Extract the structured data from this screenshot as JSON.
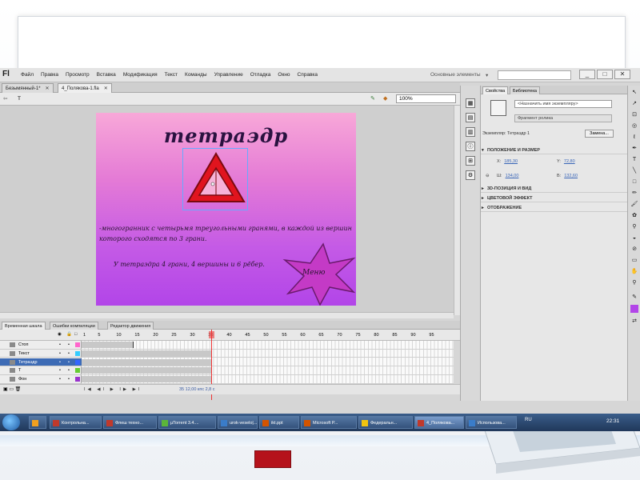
{
  "app": {
    "logo": "Fl",
    "menu": [
      "Файл",
      "Правка",
      "Просмотр",
      "Вставка",
      "Модификация",
      "Текст",
      "Команды",
      "Управление",
      "Отладка",
      "Окно",
      "Справка"
    ],
    "workspace": "Основные элементы",
    "window_buttons": [
      "_",
      "□",
      "✕"
    ]
  },
  "doc_tabs": [
    {
      "label": "Безымянный-1*",
      "active": false
    },
    {
      "label": "4_Полякова-1.fla",
      "active": true
    }
  ],
  "editbar": {
    "scene": "T",
    "zoom": "100%"
  },
  "stage": {
    "title": "тетраэдр",
    "description": "-многогранник с четырьмя треугольными гранями, в каждой из вершин которого сходятся по 3 грани.",
    "facts": "У тетраэдра 4 грани, 4  вершины и 6 рёбер.",
    "menu_label": "Меню"
  },
  "timeline": {
    "tabs": [
      "Временная шкала",
      "Ошибки компиляции",
      "Редактор движения"
    ],
    "ruler": [
      "1",
      "5",
      "10",
      "15",
      "20",
      "25",
      "30",
      "35",
      "40",
      "45",
      "50",
      "55",
      "60",
      "65",
      "70",
      "75",
      "80",
      "85",
      "90",
      "95"
    ],
    "layers": [
      {
        "name": "Стоп",
        "color": "#ff66cc",
        "selected": false,
        "frames": 0.14
      },
      {
        "name": "Текст",
        "color": "#33ccff",
        "selected": false,
        "frames": 0.35
      },
      {
        "name": "Тетраэдр",
        "color": "#3366ff",
        "selected": true,
        "frames": 0.35
      },
      {
        "name": "T",
        "color": "#66cc33",
        "selected": false,
        "frames": 0.35
      },
      {
        "name": "Фон",
        "color": "#9933cc",
        "selected": false,
        "frames": 0.35
      }
    ],
    "controls": "I◀ ◀I ▶ I▶ ▶I",
    "frame_info": "35    12,00 кпс    2,8 с"
  },
  "props": {
    "tabs": [
      "Свойства",
      "Библиотека"
    ],
    "instance_placeholder": "<Назначить имя экземпляру>",
    "symbol_type": "Фрагмент ролика",
    "instance_label": "Экземпляр:",
    "instance_name": "Тетраэдр 1",
    "swap_label": "Замена...",
    "sections": {
      "position": "ПОЛОЖЕНИЕ И РАЗМЕР",
      "3d": "3D-ПОЗИЦИЯ И ВИД",
      "color": "ЦВЕТОВОЙ ЭФФЕКТ",
      "display": "ОТОБРАЖЕНИЕ"
    },
    "x_label": "X:",
    "x_value": "185,30",
    "y_label": "Y:",
    "y_value": "72,80",
    "w_label": "Ш:",
    "w_value": "134,00",
    "h_label": "В:",
    "h_value": "132,60"
  },
  "taskbar": {
    "items": [
      {
        "label": "Контрольна...",
        "icon_color": "#c0392b"
      },
      {
        "label": "Флеш техно...",
        "icon_color": "#c0392b"
      },
      {
        "label": "µTorrent 3.4....",
        "icon_color": "#5bb53a"
      },
      {
        "label": "urok-veselo|...",
        "icon_color": "#3a7cc9"
      },
      {
        "label": "ikt.ppt",
        "icon_color": "#d35400"
      },
      {
        "label": "Microsoft P...",
        "icon_color": "#d35400"
      },
      {
        "label": "Федеральн...",
        "icon_color": "#f1c40f"
      },
      {
        "label": "4_Полякова...",
        "icon_color": "#c0392b"
      },
      {
        "label": "Использова...",
        "icon_color": "#3a7cc9"
      }
    ],
    "lang": "RU",
    "time": "22:31"
  },
  "colors": {
    "stage_top": "#f8a8d8",
    "stage_bottom": "#b245e8",
    "triangle": "#e0141e",
    "star": "#c43ac6",
    "selection": "#3d6bb5"
  }
}
